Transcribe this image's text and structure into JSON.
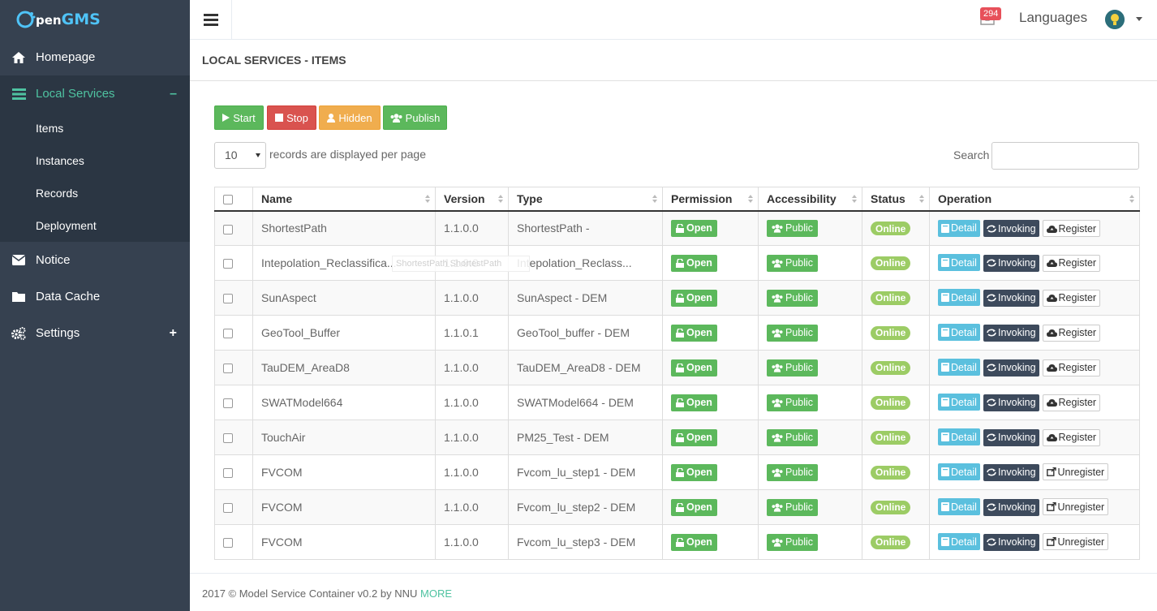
{
  "brand": {
    "logo_text": "OpenGMS"
  },
  "sidebar": {
    "items": [
      {
        "label": "Homepage",
        "icon": "home-icon"
      },
      {
        "label": "Local Services",
        "icon": "server-icon",
        "toggle": "–"
      },
      {
        "label": "Notice",
        "icon": "envelope-icon"
      },
      {
        "label": "Data Cache",
        "icon": "folder-icon"
      },
      {
        "label": "Settings",
        "icon": "gears-icon",
        "toggle": "+"
      }
    ],
    "sub_items": [
      "Items",
      "Instances",
      "Records",
      "Deployment"
    ]
  },
  "header": {
    "notify_count": "294",
    "languages_label": "Languages"
  },
  "page": {
    "title": "LOCAL SERVICES - ITEMS"
  },
  "toolbar": {
    "start": "Start",
    "stop": "Stop",
    "hidden": "Hidden",
    "publish": "Publish"
  },
  "pager": {
    "page_size": "10",
    "per_page_text": "records are displayed per page",
    "search_label": "Search"
  },
  "table": {
    "columns": [
      "Name",
      "Version",
      "Type",
      "Permission",
      "Accessibility",
      "Status",
      "Operation"
    ],
    "rows": [
      {
        "name": "ShortestPath",
        "version": "1.1.0.0",
        "type": "ShortestPath -",
        "permission": "Open",
        "access": "Public",
        "status": "Online",
        "detail": "Detail",
        "invoke": "Invoking",
        "reg": "Register"
      },
      {
        "name": "Intepolation_Reclassifica...",
        "version": "1.1.0.0",
        "type": "Intepolation_Reclass...",
        "permission": "Open",
        "access": "Public",
        "status": "Online",
        "detail": "Detail",
        "invoke": "Invoking",
        "reg": "Register"
      },
      {
        "name": "SunAspect",
        "version": "1.1.0.0",
        "type": "SunAspect - DEM",
        "permission": "Open",
        "access": "Public",
        "status": "Online",
        "detail": "Detail",
        "invoke": "Invoking",
        "reg": "Register"
      },
      {
        "name": "GeoTool_Buffer",
        "version": "1.1.0.1",
        "type": "GeoTool_buffer - DEM",
        "permission": "Open",
        "access": "Public",
        "status": "Online",
        "detail": "Detail",
        "invoke": "Invoking",
        "reg": "Register"
      },
      {
        "name": "TauDEM_AreaD8",
        "version": "1.1.0.0",
        "type": "TauDEM_AreaD8 - DEM",
        "permission": "Open",
        "access": "Public",
        "status": "Online",
        "detail": "Detail",
        "invoke": "Invoking",
        "reg": "Register"
      },
      {
        "name": "SWATModel664",
        "version": "1.1.0.0",
        "type": "SWATModel664 - DEM",
        "permission": "Open",
        "access": "Public",
        "status": "Online",
        "detail": "Detail",
        "invoke": "Invoking",
        "reg": "Register"
      },
      {
        "name": "TouchAir",
        "version": "1.1.0.0",
        "type": "PM25_Test - DEM",
        "permission": "Open",
        "access": "Public",
        "status": "Online",
        "detail": "Detail",
        "invoke": "Invoking",
        "reg": "Register"
      },
      {
        "name": "FVCOM",
        "version": "1.1.0.0",
        "type": "Fvcom_lu_step1 - DEM",
        "permission": "Open",
        "access": "Public",
        "status": "Online",
        "detail": "Detail",
        "invoke": "Invoking",
        "reg": "Unregister"
      },
      {
        "name": "FVCOM",
        "version": "1.1.0.0",
        "type": "Fvcom_lu_step2 - DEM",
        "permission": "Open",
        "access": "Public",
        "status": "Online",
        "detail": "Detail",
        "invoke": "Invoking",
        "reg": "Unregister"
      },
      {
        "name": "FVCOM",
        "version": "1.1.0.0",
        "type": "Fvcom_lu_step3 - DEM",
        "permission": "Open",
        "access": "Public",
        "status": "Online",
        "detail": "Detail",
        "invoke": "Invoking",
        "reg": "Unregister"
      }
    ]
  },
  "tooltip": {
    "text": "ShortestPath ShortestPath"
  },
  "footer": {
    "text": "2017 © Model Service Container v0.2 by NNU",
    "more": "MORE"
  },
  "colors": {
    "sidebar_bg": "#364150",
    "accent": "#4fc3a1",
    "success": "#5cb85c",
    "danger": "#d9534f",
    "warning": "#f0ad4e",
    "info": "#5bc0de"
  }
}
